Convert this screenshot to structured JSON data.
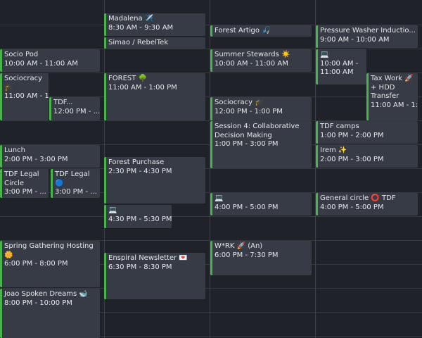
{
  "colors": {
    "background": "#1f2228",
    "event_bg": "#373b45",
    "event_accent": "#4bb34b",
    "grid_line": "#343841",
    "text": "#e6e7ea"
  },
  "events": [
    {
      "id": "madalena",
      "col": 1,
      "title": "Madalena ✈️",
      "time": "8:30 AM - 9:30 AM"
    },
    {
      "id": "simao",
      "col": 1,
      "title": "Simao / RebelTek",
      "time": ""
    },
    {
      "id": "forest-artigo",
      "col": 2,
      "title": "Forest Artigo 🎣",
      "time": ""
    },
    {
      "id": "pressure-washer",
      "col": 3,
      "title": "Pressure Washer Inductio...",
      "time": "9:00 AM - 10:00 AM"
    },
    {
      "id": "socio-pod",
      "col": 0,
      "title": "Socio Pod",
      "time": "10:00 AM - 11:00 AM"
    },
    {
      "id": "summer-stewards",
      "col": 2,
      "title": "Summer Stewards ☀️",
      "time": "10:00 AM - 11:00 AM"
    },
    {
      "id": "laptop-1",
      "col": 3,
      "title": "💻",
      "time": "10:00 AM - 11:00 AM"
    },
    {
      "id": "sociocracy-1",
      "col": 0,
      "title": "Sociocracy 🎓",
      "time": "11:00 AM - 1:..."
    },
    {
      "id": "forest",
      "col": 1,
      "title": "FOREST 🌳",
      "time": "11:00 AM - 1:00 PM"
    },
    {
      "id": "tax-work",
      "col": 3,
      "title": "Tax Work 🚀 + HDD Transfer",
      "time": "11:00 AM - 1:..."
    },
    {
      "id": "tdf-1",
      "col": 0,
      "title": "TDF...",
      "time": "12:00 PM - ..."
    },
    {
      "id": "sociocracy-2",
      "col": 2,
      "title": "Sociocracy 🎓",
      "time": "12:00 PM - 1:00 PM"
    },
    {
      "id": "session-4",
      "col": 2,
      "title": "Session 4: Collaborative Decision Making",
      "time": "1:00 PM - 3:00 PM"
    },
    {
      "id": "tdf-camps",
      "col": 3,
      "title": "TDF camps",
      "time": "1:00 PM - 2:00 PM"
    },
    {
      "id": "lunch",
      "col": 0,
      "title": "Lunch",
      "time": "2:00 PM - 3:00 PM"
    },
    {
      "id": "irem",
      "col": 3,
      "title": "Irem ✨",
      "time": "2:00 PM - 3:00 PM"
    },
    {
      "id": "forest-purchase",
      "col": 1,
      "title": "Forest Purchase",
      "time": "2:30 PM - 4:30 PM"
    },
    {
      "id": "tdf-legal-circle",
      "col": 0,
      "title": "TDF Legal Circle",
      "time": "3:00 PM - ..."
    },
    {
      "id": "tdf-legal",
      "col": 0,
      "title": "TDF Legal 🔵",
      "time": "3:00 PM - ..."
    },
    {
      "id": "laptop-2",
      "col": 2,
      "title": "💻",
      "time": "4:00 PM - 5:00 PM"
    },
    {
      "id": "general-circle",
      "col": 3,
      "title": "General circle ⭕ TDF",
      "time": "4:00 PM - 5:00 PM"
    },
    {
      "id": "laptop-3",
      "col": 1,
      "title": "💻",
      "time": "4:30 PM - 5:30 PM"
    },
    {
      "id": "spring-gathering",
      "col": 0,
      "title": "Spring Gathering Hosting 🌼",
      "time": "6:00 PM - 8:00 PM"
    },
    {
      "id": "work-an",
      "col": 2,
      "title": "W*RK 🚀 (An)",
      "time": "6:00 PM - 7:30 PM"
    },
    {
      "id": "enspiral",
      "col": 1,
      "title": "Enspiral Newsletter 💌",
      "time": "6:30 PM - 8:30 PM"
    },
    {
      "id": "joao",
      "col": 0,
      "title": "Joao Spoken Dreams 🐋",
      "time": "8:00 PM - 10:00 PM"
    }
  ]
}
